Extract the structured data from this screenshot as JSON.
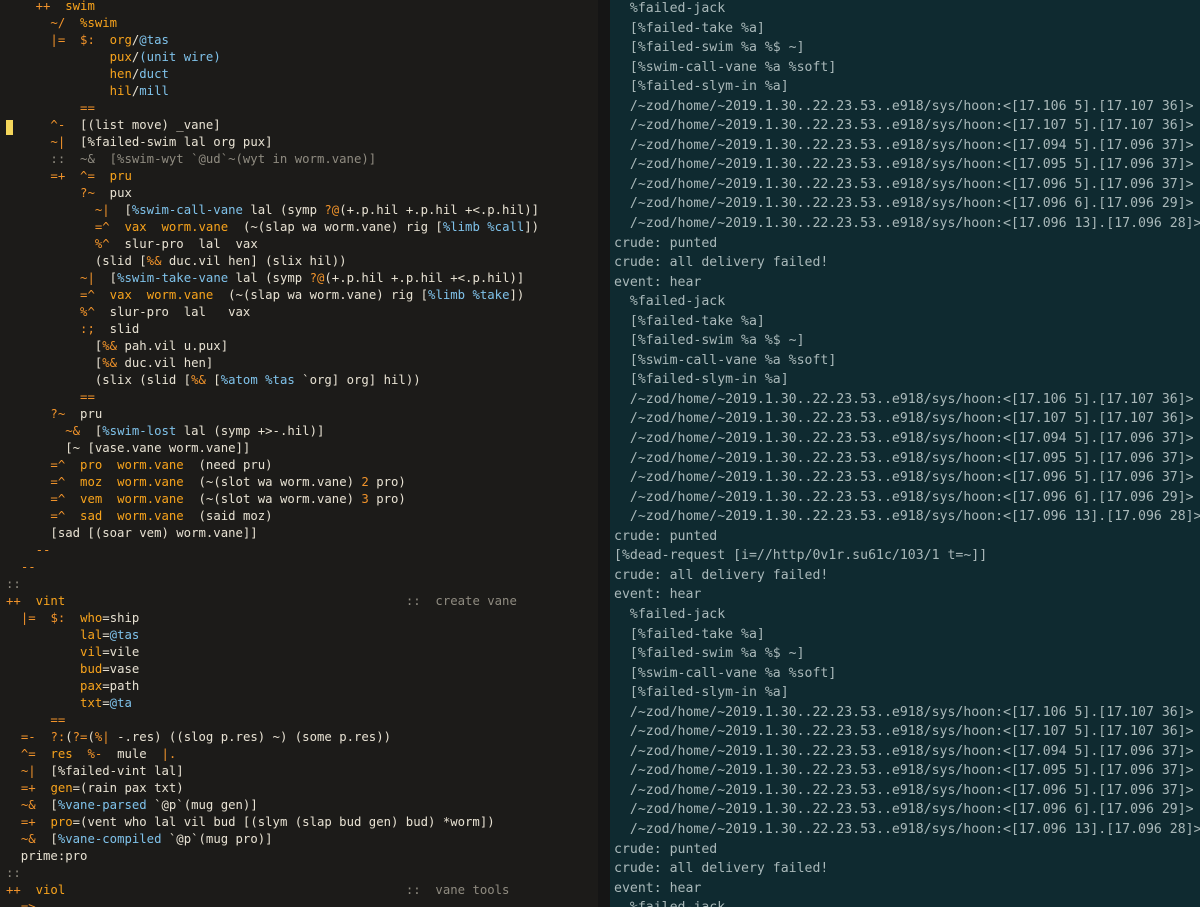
{
  "colors": {
    "default": "#e7e1d2",
    "rune": "#f0932b",
    "name": "#f7a31c",
    "type": "#7fc2ea",
    "dim": "#8f8b80",
    "log": "#a9b8b9"
  },
  "editor": {
    "lines": [
      [
        [
          "    ",
          "d"
        ],
        [
          "++",
          "r"
        ],
        [
          "  ",
          "d"
        ],
        [
          "swim",
          "n"
        ]
      ],
      [
        [
          "      ",
          "d"
        ],
        [
          "~/",
          "r"
        ],
        [
          "  ",
          "d"
        ],
        [
          "%swim",
          "n"
        ]
      ],
      [
        [
          "      ",
          "d"
        ],
        [
          "|=",
          "r"
        ],
        [
          "  ",
          "d"
        ],
        [
          "$:",
          "r"
        ],
        [
          "  ",
          "d"
        ],
        [
          "org",
          "n"
        ],
        [
          "/",
          "d"
        ],
        [
          "@tas",
          "t"
        ]
      ],
      [
        [
          "              ",
          "d"
        ],
        [
          "pux",
          "n"
        ],
        [
          "/",
          "d"
        ],
        [
          "(unit wire)",
          "t"
        ]
      ],
      [
        [
          "              ",
          "d"
        ],
        [
          "hen",
          "n"
        ],
        [
          "/",
          "d"
        ],
        [
          "duct",
          "t"
        ]
      ],
      [
        [
          "              ",
          "d"
        ],
        [
          "hil",
          "n"
        ],
        [
          "/",
          "d"
        ],
        [
          "mill",
          "t"
        ]
      ],
      [
        [
          "          ",
          "d"
        ],
        [
          "==",
          "r"
        ]
      ],
      [
        [
          "      ",
          "d"
        ],
        [
          "^-",
          "r"
        ],
        [
          "  ",
          "d"
        ],
        [
          "[(list move) _vane]",
          "d"
        ]
      ],
      [
        [
          "      ",
          "d"
        ],
        [
          "~|",
          "r"
        ],
        [
          "  ",
          "d"
        ],
        [
          "[%failed-swim lal org pux]",
          "d"
        ]
      ],
      [
        [
          "      ",
          "d"
        ],
        [
          "::  ~&  [%swim-wyt `@ud`~(wyt in worm.vane)]",
          "m"
        ]
      ],
      [
        [
          "      ",
          "d"
        ],
        [
          "=+",
          "r"
        ],
        [
          "  ",
          "d"
        ],
        [
          "^=",
          "r"
        ],
        [
          "  ",
          "d"
        ],
        [
          "pru",
          "n"
        ]
      ],
      [
        [
          "          ",
          "d"
        ],
        [
          "?~",
          "r"
        ],
        [
          "  ",
          "d"
        ],
        [
          "pux",
          "d"
        ]
      ],
      [
        [
          "            ",
          "d"
        ],
        [
          "~|",
          "r"
        ],
        [
          "  ",
          "d"
        ],
        [
          "[",
          "d"
        ],
        [
          "%swim-call-vane",
          "t"
        ],
        [
          " lal (symp ",
          "d"
        ],
        [
          "?@",
          "r"
        ],
        [
          "(+.p.hil +.p.hil +<.p.hil)]",
          "d"
        ]
      ],
      [
        [
          "            ",
          "d"
        ],
        [
          "=^",
          "r"
        ],
        [
          "  ",
          "d"
        ],
        [
          "vax",
          "n"
        ],
        [
          "  ",
          "d"
        ],
        [
          "worm.vane",
          "n"
        ],
        [
          "  (~(slap wa worm.vane) rig [",
          "d"
        ],
        [
          "%limb %call",
          "t"
        ],
        [
          "])",
          "d"
        ]
      ],
      [
        [
          "            ",
          "d"
        ],
        [
          "%^",
          "r"
        ],
        [
          "  slur-pro  lal  vax",
          "d"
        ]
      ],
      [
        [
          "            ",
          "d"
        ],
        [
          "(slid [",
          "d"
        ],
        [
          "%&",
          "r"
        ],
        [
          " duc.vil hen] (slix hil))",
          "d"
        ]
      ],
      [
        [
          "          ",
          "d"
        ],
        [
          "~|",
          "r"
        ],
        [
          "  ",
          "d"
        ],
        [
          "[",
          "d"
        ],
        [
          "%swim-take-vane",
          "t"
        ],
        [
          " lal (symp ",
          "d"
        ],
        [
          "?@",
          "r"
        ],
        [
          "(+.p.hil +.p.hil +<.p.hil)]",
          "d"
        ]
      ],
      [
        [
          "          ",
          "d"
        ],
        [
          "=^",
          "r"
        ],
        [
          "  ",
          "d"
        ],
        [
          "vax",
          "n"
        ],
        [
          "  ",
          "d"
        ],
        [
          "worm.vane",
          "n"
        ],
        [
          "  (~(slap wa worm.vane) rig [",
          "d"
        ],
        [
          "%limb %take",
          "t"
        ],
        [
          "])",
          "d"
        ]
      ],
      [
        [
          "          ",
          "d"
        ],
        [
          "%^",
          "r"
        ],
        [
          "  slur-pro  lal   vax",
          "d"
        ]
      ],
      [
        [
          "          ",
          "d"
        ],
        [
          ":;",
          "r"
        ],
        [
          "  slid",
          "d"
        ]
      ],
      [
        [
          "            ",
          "d"
        ],
        [
          "[",
          "d"
        ],
        [
          "%&",
          "r"
        ],
        [
          " pah.vil u.pux]",
          "d"
        ]
      ],
      [
        [
          "            ",
          "d"
        ],
        [
          "[",
          "d"
        ],
        [
          "%&",
          "r"
        ],
        [
          " duc.vil hen]",
          "d"
        ]
      ],
      [
        [
          "            ",
          "d"
        ],
        [
          "(slix (slid [",
          "d"
        ],
        [
          "%&",
          "r"
        ],
        [
          " [",
          "d"
        ],
        [
          "%atom %tas",
          "t"
        ],
        [
          " `org] org] hil))",
          "d"
        ]
      ],
      [
        [
          "          ",
          "d"
        ],
        [
          "==",
          "r"
        ]
      ],
      [
        [
          "      ",
          "d"
        ],
        [
          "?~",
          "r"
        ],
        [
          "  pru",
          "d"
        ]
      ],
      [
        [
          "        ",
          "d"
        ],
        [
          "~&",
          "r"
        ],
        [
          "  [",
          "d"
        ],
        [
          "%swim-lost",
          "t"
        ],
        [
          " lal (symp +>-.hil)]",
          "d"
        ]
      ],
      [
        [
          "        ",
          "d"
        ],
        [
          "[~ [vase.vane worm.vane]]",
          "d"
        ]
      ],
      [
        [
          "      ",
          "d"
        ],
        [
          "=^",
          "r"
        ],
        [
          "  ",
          "d"
        ],
        [
          "pro",
          "n"
        ],
        [
          "  ",
          "d"
        ],
        [
          "worm.vane",
          "n"
        ],
        [
          "  (need pru)",
          "d"
        ]
      ],
      [
        [
          "      ",
          "d"
        ],
        [
          "=^",
          "r"
        ],
        [
          "  ",
          "d"
        ],
        [
          "moz",
          "n"
        ],
        [
          "  ",
          "d"
        ],
        [
          "worm.vane",
          "n"
        ],
        [
          "  (~(slot wa worm.vane) ",
          "d"
        ],
        [
          "2",
          "r"
        ],
        [
          " pro)",
          "d"
        ]
      ],
      [
        [
          "      ",
          "d"
        ],
        [
          "=^",
          "r"
        ],
        [
          "  ",
          "d"
        ],
        [
          "vem",
          "n"
        ],
        [
          "  ",
          "d"
        ],
        [
          "worm.vane",
          "n"
        ],
        [
          "  (~(slot wa worm.vane) ",
          "d"
        ],
        [
          "3",
          "r"
        ],
        [
          " pro)",
          "d"
        ]
      ],
      [
        [
          "      ",
          "d"
        ],
        [
          "=^",
          "r"
        ],
        [
          "  ",
          "d"
        ],
        [
          "sad",
          "n"
        ],
        [
          "  ",
          "d"
        ],
        [
          "worm.vane",
          "n"
        ],
        [
          "  (said moz)",
          "d"
        ]
      ],
      [
        [
          "      [sad [(soar vem) worm.vane]]",
          "d"
        ]
      ],
      [
        [
          "    ",
          "d"
        ],
        [
          "--",
          "r"
        ]
      ],
      [
        [
          "  ",
          "d"
        ],
        [
          "--",
          "r"
        ]
      ],
      [
        [
          "::",
          "m"
        ]
      ],
      [
        [
          "++",
          "r"
        ],
        [
          "  ",
          "d"
        ],
        [
          "vint",
          "n"
        ],
        [
          "                                              ",
          "d"
        ],
        [
          "::  create vane",
          "m"
        ]
      ],
      [
        [
          "  ",
          "d"
        ],
        [
          "|=",
          "r"
        ],
        [
          "  ",
          "d"
        ],
        [
          "$:",
          "r"
        ],
        [
          "  ",
          "d"
        ],
        [
          "who",
          "n"
        ],
        [
          "=",
          "d"
        ],
        [
          "ship",
          "d"
        ]
      ],
      [
        [
          "          ",
          "d"
        ],
        [
          "lal",
          "n"
        ],
        [
          "=",
          "d"
        ],
        [
          "@tas",
          "t"
        ]
      ],
      [
        [
          "          ",
          "d"
        ],
        [
          "vil",
          "n"
        ],
        [
          "=",
          "d"
        ],
        [
          "vile",
          "d"
        ]
      ],
      [
        [
          "          ",
          "d"
        ],
        [
          "bud",
          "n"
        ],
        [
          "=",
          "d"
        ],
        [
          "vase",
          "d"
        ]
      ],
      [
        [
          "          ",
          "d"
        ],
        [
          "pax",
          "n"
        ],
        [
          "=",
          "d"
        ],
        [
          "path",
          "d"
        ]
      ],
      [
        [
          "          ",
          "d"
        ],
        [
          "txt",
          "n"
        ],
        [
          "=",
          "d"
        ],
        [
          "@ta",
          "t"
        ]
      ],
      [
        [
          "      ",
          "d"
        ],
        [
          "==",
          "r"
        ]
      ],
      [
        [
          "  ",
          "d"
        ],
        [
          "=-",
          "r"
        ],
        [
          "  ",
          "d"
        ],
        [
          "?:",
          "r"
        ],
        [
          "(",
          "d"
        ],
        [
          "?=",
          "r"
        ],
        [
          "(",
          "d"
        ],
        [
          "%|",
          "r"
        ],
        [
          " -.res) ((slog p.res) ~) (some p.res))",
          "d"
        ]
      ],
      [
        [
          "  ",
          "d"
        ],
        [
          "^=",
          "r"
        ],
        [
          "  ",
          "d"
        ],
        [
          "res",
          "n"
        ],
        [
          "  ",
          "d"
        ],
        [
          "%-",
          "r"
        ],
        [
          "  mule  ",
          "d"
        ],
        [
          "|.",
          "r"
        ]
      ],
      [
        [
          "  ",
          "d"
        ],
        [
          "~|",
          "r"
        ],
        [
          "  [%failed-vint lal]",
          "d"
        ]
      ],
      [
        [
          "  ",
          "d"
        ],
        [
          "=+",
          "r"
        ],
        [
          "  ",
          "d"
        ],
        [
          "gen",
          "n"
        ],
        [
          "=(rain pax txt)",
          "d"
        ]
      ],
      [
        [
          "  ",
          "d"
        ],
        [
          "~&",
          "r"
        ],
        [
          "  [",
          "d"
        ],
        [
          "%vane-parsed",
          "t"
        ],
        [
          " `@p`(mug gen)]",
          "d"
        ]
      ],
      [
        [
          "  ",
          "d"
        ],
        [
          "=+",
          "r"
        ],
        [
          "  ",
          "d"
        ],
        [
          "pro",
          "n"
        ],
        [
          "=(vent who lal vil bud [(slym (slap bud gen) bud) *worm])",
          "d"
        ]
      ],
      [
        [
          "  ",
          "d"
        ],
        [
          "~&",
          "r"
        ],
        [
          "  [",
          "d"
        ],
        [
          "%vane-compiled",
          "t"
        ],
        [
          " `@p`(mug pro)]",
          "d"
        ]
      ],
      [
        [
          "  prime:pro",
          "d"
        ]
      ],
      [
        [
          "::",
          "m"
        ]
      ],
      [
        [
          "++",
          "r"
        ],
        [
          "  ",
          "d"
        ],
        [
          "viol",
          "n"
        ],
        [
          "                                              ",
          "d"
        ],
        [
          "::  vane tools",
          "m"
        ]
      ],
      [
        [
          "  ",
          "d"
        ],
        [
          "=>",
          "r"
        ],
        [
          "  ",
          "d"
        ],
        [
          "..",
          "d"
        ]
      ]
    ]
  },
  "terminal": {
    "lines": [
      "  %failed-jack",
      "  [%failed-take %a]",
      "  [%failed-swim %a %$ ~]",
      "  [%swim-call-vane %a %soft]",
      "  [%failed-slym-in %a]",
      "  /~zod/home/~2019.1.30..22.23.53..e918/sys/hoon:<[17.106 5].[17.107 36]>",
      "  /~zod/home/~2019.1.30..22.23.53..e918/sys/hoon:<[17.107 5].[17.107 36]>",
      "  /~zod/home/~2019.1.30..22.23.53..e918/sys/hoon:<[17.094 5].[17.096 37]>",
      "  /~zod/home/~2019.1.30..22.23.53..e918/sys/hoon:<[17.095 5].[17.096 37]>",
      "  /~zod/home/~2019.1.30..22.23.53..e918/sys/hoon:<[17.096 5].[17.096 37]>",
      "  /~zod/home/~2019.1.30..22.23.53..e918/sys/hoon:<[17.096 6].[17.096 29]>",
      "  /~zod/home/~2019.1.30..22.23.53..e918/sys/hoon:<[17.096 13].[17.096 28]>",
      "crude: punted",
      "crude: all delivery failed!",
      "event: hear",
      "  %failed-jack",
      "  [%failed-take %a]",
      "  [%failed-swim %a %$ ~]",
      "  [%swim-call-vane %a %soft]",
      "  [%failed-slym-in %a]",
      "  /~zod/home/~2019.1.30..22.23.53..e918/sys/hoon:<[17.106 5].[17.107 36]>",
      "  /~zod/home/~2019.1.30..22.23.53..e918/sys/hoon:<[17.107 5].[17.107 36]>",
      "  /~zod/home/~2019.1.30..22.23.53..e918/sys/hoon:<[17.094 5].[17.096 37]>",
      "  /~zod/home/~2019.1.30..22.23.53..e918/sys/hoon:<[17.095 5].[17.096 37]>",
      "  /~zod/home/~2019.1.30..22.23.53..e918/sys/hoon:<[17.096 5].[17.096 37]>",
      "  /~zod/home/~2019.1.30..22.23.53..e918/sys/hoon:<[17.096 6].[17.096 29]>",
      "  /~zod/home/~2019.1.30..22.23.53..e918/sys/hoon:<[17.096 13].[17.096 28]>",
      "crude: punted",
      "[%dead-request [i=//http/0v1r.su61c/103/1 t=~]]",
      "crude: all delivery failed!",
      "event: hear",
      "  %failed-jack",
      "  [%failed-take %a]",
      "  [%failed-swim %a %$ ~]",
      "  [%swim-call-vane %a %soft]",
      "  [%failed-slym-in %a]",
      "  /~zod/home/~2019.1.30..22.23.53..e918/sys/hoon:<[17.106 5].[17.107 36]>",
      "  /~zod/home/~2019.1.30..22.23.53..e918/sys/hoon:<[17.107 5].[17.107 36]>",
      "  /~zod/home/~2019.1.30..22.23.53..e918/sys/hoon:<[17.094 5].[17.096 37]>",
      "  /~zod/home/~2019.1.30..22.23.53..e918/sys/hoon:<[17.095 5].[17.096 37]>",
      "  /~zod/home/~2019.1.30..22.23.53..e918/sys/hoon:<[17.096 5].[17.096 37]>",
      "  /~zod/home/~2019.1.30..22.23.53..e918/sys/hoon:<[17.096 6].[17.096 29]>",
      "  /~zod/home/~2019.1.30..22.23.53..e918/sys/hoon:<[17.096 13].[17.096 28]>",
      "crude: punted",
      "crude: all delivery failed!",
      "event: hear",
      "  %failed-jack"
    ]
  }
}
